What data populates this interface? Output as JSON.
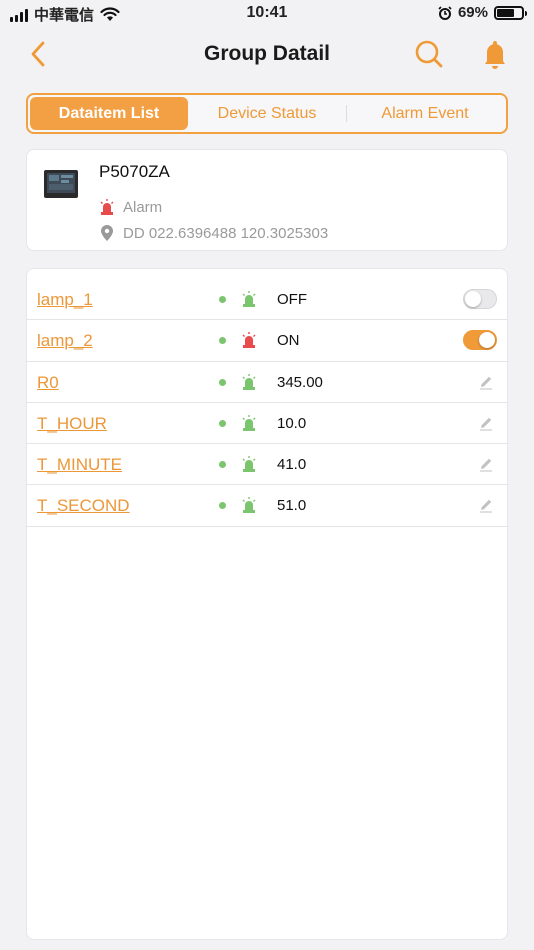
{
  "status_bar": {
    "carrier": "中華電信",
    "time": "10:41",
    "battery": "69%",
    "battery_level": 0.69
  },
  "header": {
    "title": "Group Datail",
    "back_icon": "chevron-left-icon",
    "search_icon": "search-icon",
    "bell_icon": "bell-icon"
  },
  "tabs": [
    {
      "label": "Dataitem List",
      "active": true
    },
    {
      "label": "Device Status",
      "active": false
    },
    {
      "label": "Alarm Event",
      "active": false
    }
  ],
  "device": {
    "name": "P5070ZA",
    "alarm_label": "Alarm",
    "location": "DD 022.6396488 120.3025303",
    "accent_color": "#f09a38"
  },
  "dataitems": [
    {
      "name": "lamp_1",
      "value": "OFF",
      "control": "toggle",
      "on": false,
      "lamp_color": "#7cc56f"
    },
    {
      "name": "lamp_2",
      "value": "ON",
      "control": "toggle",
      "on": true,
      "lamp_color": "#e84b4b"
    },
    {
      "name": "R0",
      "value": "345.00",
      "control": "edit",
      "lamp_color": "#7cc56f"
    },
    {
      "name": "T_HOUR",
      "value": "10.0",
      "control": "edit",
      "lamp_color": "#7cc56f"
    },
    {
      "name": "T_MINUTE",
      "value": "41.0",
      "control": "edit",
      "lamp_color": "#7cc56f"
    },
    {
      "name": "T_SECOND",
      "value": "51.0",
      "control": "edit",
      "lamp_color": "#7cc56f"
    }
  ]
}
